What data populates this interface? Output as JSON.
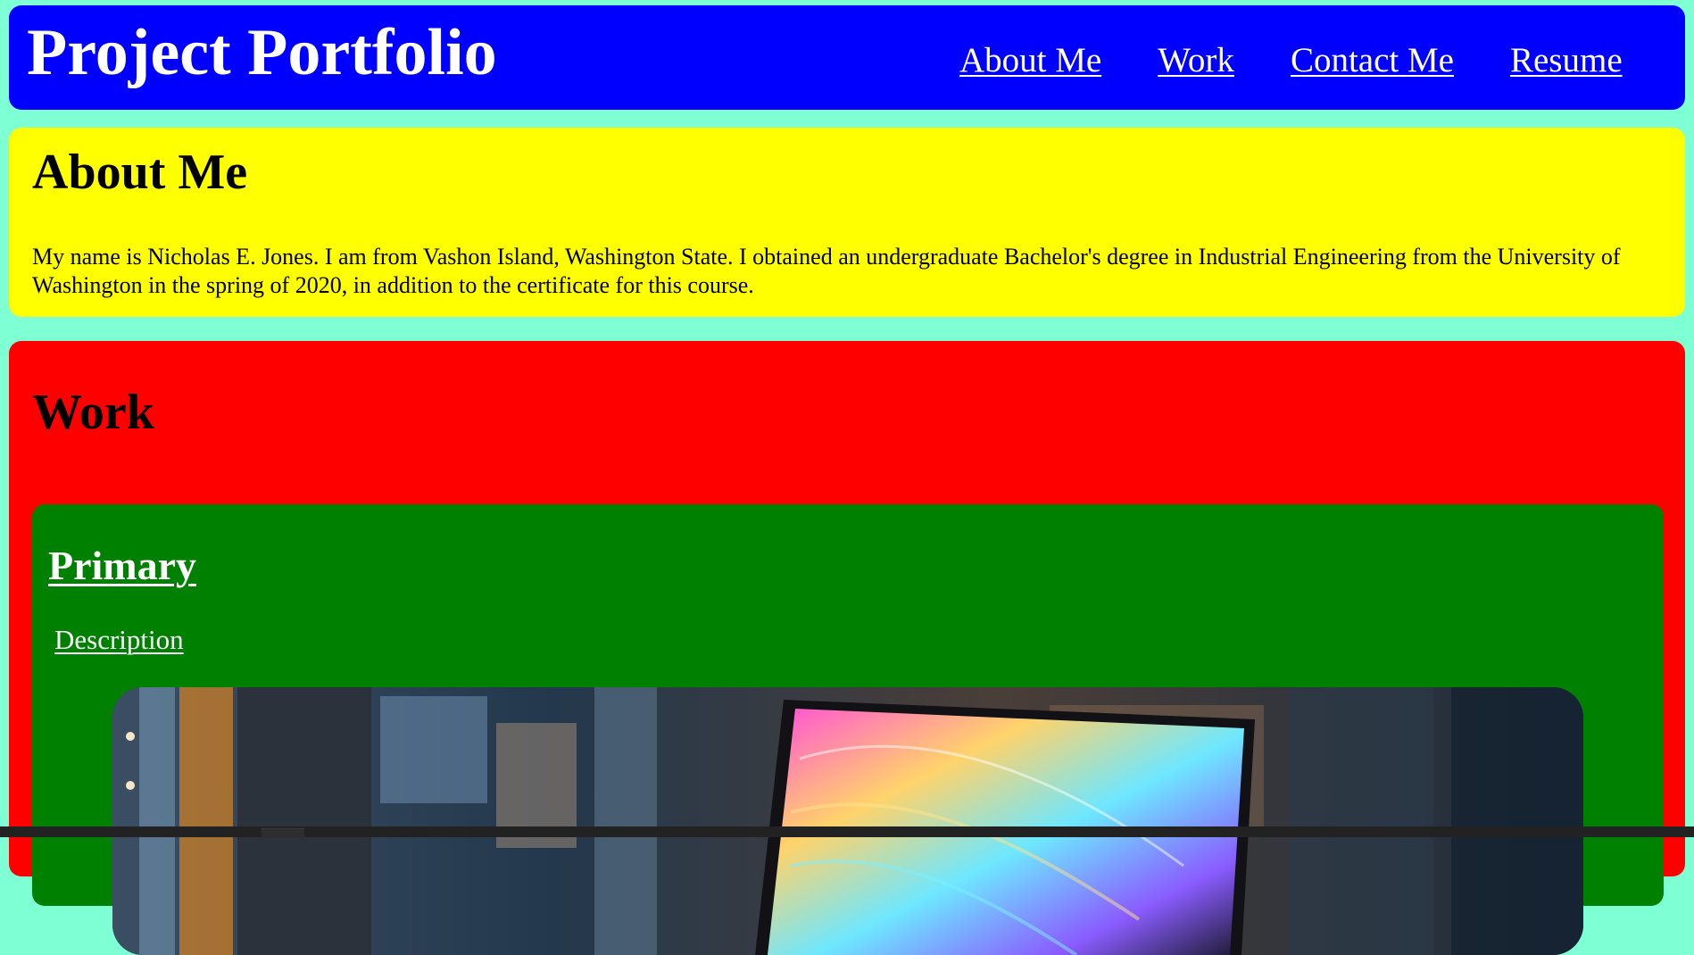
{
  "header": {
    "title": "Project Portfolio",
    "nav": [
      "About Me",
      "Work",
      "Contact Me",
      "Resume"
    ],
    "background": "#0000ff"
  },
  "about": {
    "heading": "About Me",
    "text": "My name is Nicholas E. Jones. I am from Vashon Island, Washington State. I obtained an undergraduate Bachelor's degree in Industrial Engineering from the University of Washington in the spring of 2020, in addition to the certificate for this course.",
    "background": "#ffff00"
  },
  "work": {
    "heading": "Work",
    "background": "#ff0000",
    "card": {
      "title": "Primary",
      "description_link": "Description",
      "background": "#008000",
      "image_subject": "laptop with colorful swirl wallpaper in an office"
    }
  },
  "page": {
    "background": "#7fffd4"
  }
}
